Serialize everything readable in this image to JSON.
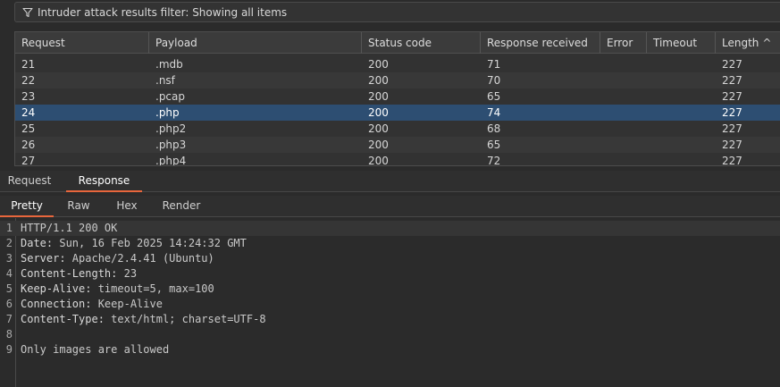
{
  "filter": {
    "text": "Intruder attack results filter: Showing all items"
  },
  "table": {
    "columns": [
      "Request",
      "Payload",
      "Status code",
      "Response received",
      "Error",
      "Timeout",
      "Length"
    ],
    "sort_indicator": "^",
    "rows": [
      {
        "request": "21",
        "payload": ".mdb",
        "status": "200",
        "received": "71",
        "error": "",
        "timeout": "",
        "length": "227"
      },
      {
        "request": "22",
        "payload": ".nsf",
        "status": "200",
        "received": "70",
        "error": "",
        "timeout": "",
        "length": "227"
      },
      {
        "request": "23",
        "payload": ".pcap",
        "status": "200",
        "received": "65",
        "error": "",
        "timeout": "",
        "length": "227"
      },
      {
        "request": "24",
        "payload": ".php",
        "status": "200",
        "received": "74",
        "error": "",
        "timeout": "",
        "length": "227"
      },
      {
        "request": "25",
        "payload": ".php2",
        "status": "200",
        "received": "68",
        "error": "",
        "timeout": "",
        "length": "227"
      },
      {
        "request": "26",
        "payload": ".php3",
        "status": "200",
        "received": "65",
        "error": "",
        "timeout": "",
        "length": "227"
      },
      {
        "request": "27",
        "payload": ".php4",
        "status": "200",
        "received": "72",
        "error": "",
        "timeout": "",
        "length": "227"
      }
    ],
    "selected_request": "24"
  },
  "message_tabs": {
    "request": "Request",
    "response": "Response",
    "active": "Response"
  },
  "view_tabs": {
    "pretty": "Pretty",
    "raw": "Raw",
    "hex": "Hex",
    "render": "Render",
    "active": "Pretty"
  },
  "response": {
    "lines": [
      {
        "num": "1",
        "key": "",
        "value": "HTTP/1.1 200 OK"
      },
      {
        "num": "2",
        "key": "Date:",
        "value": " Sun, 16 Feb 2025 14:24:32 GMT"
      },
      {
        "num": "3",
        "key": "Server:",
        "value": " Apache/2.4.41 (Ubuntu)"
      },
      {
        "num": "4",
        "key": "Content-Length:",
        "value": " 23"
      },
      {
        "num": "5",
        "key": "Keep-Alive:",
        "value": " timeout=5, max=100"
      },
      {
        "num": "6",
        "key": "Connection:",
        "value": " Keep-Alive"
      },
      {
        "num": "7",
        "key": "Content-Type:",
        "value": " text/html; charset=UTF-8"
      },
      {
        "num": "8",
        "key": "",
        "value": ""
      },
      {
        "num": "9",
        "key": "",
        "value": "Only images are allowed"
      }
    ]
  }
}
